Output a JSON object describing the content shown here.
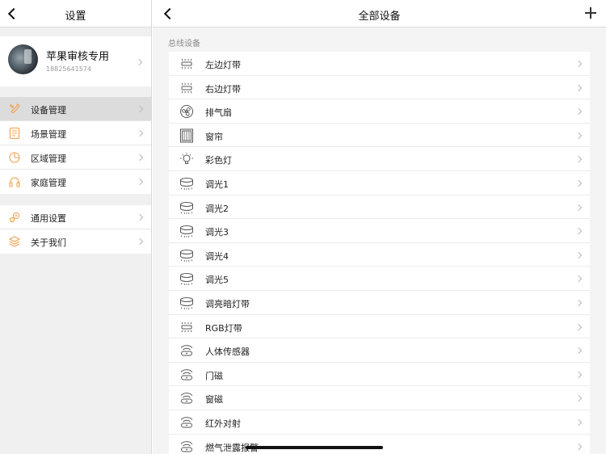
{
  "settings": {
    "title": "设置",
    "profile": {
      "name": "苹果审核专用",
      "phone": "18825641574"
    },
    "menu_group1": [
      {
        "label": "设备管理",
        "icon": "tools-icon",
        "active": true
      },
      {
        "label": "场景管理",
        "icon": "document-icon"
      },
      {
        "label": "区域管理",
        "icon": "pie-chart-icon"
      },
      {
        "label": "家庭管理",
        "icon": "headset-icon"
      }
    ],
    "menu_group2": [
      {
        "label": "通用设置",
        "icon": "gears-icon"
      },
      {
        "label": "关于我们",
        "icon": "layers-icon"
      }
    ]
  },
  "devices": {
    "title": "全部设备",
    "section": "总线设备",
    "items": [
      {
        "label": "左边灯带",
        "icon": "light-strip-icon"
      },
      {
        "label": "右边灯带",
        "icon": "light-strip-icon"
      },
      {
        "label": "排气扇",
        "icon": "fan-icon"
      },
      {
        "label": "窗帘",
        "icon": "curtain-icon"
      },
      {
        "label": "彩色灯",
        "icon": "bulb-icon"
      },
      {
        "label": "调光1",
        "icon": "dimmer-icon"
      },
      {
        "label": "调光2",
        "icon": "dimmer-icon"
      },
      {
        "label": "调光3",
        "icon": "dimmer-icon"
      },
      {
        "label": "调光4",
        "icon": "dimmer-icon"
      },
      {
        "label": "调光5",
        "icon": "dimmer-icon"
      },
      {
        "label": "调亮暗灯带",
        "icon": "dimmer-icon"
      },
      {
        "label": "RGB灯带",
        "icon": "light-strip-icon"
      },
      {
        "label": "人体传感器",
        "icon": "sensor-icon"
      },
      {
        "label": "门磁",
        "icon": "sensor-icon"
      },
      {
        "label": "窗磁",
        "icon": "sensor-icon"
      },
      {
        "label": "红外对射",
        "icon": "sensor-icon"
      },
      {
        "label": "燃气泄露报警",
        "icon": "sensor-icon"
      }
    ]
  },
  "colors": {
    "accent": "#f0a04b",
    "active_row": "#dcdcdc"
  }
}
